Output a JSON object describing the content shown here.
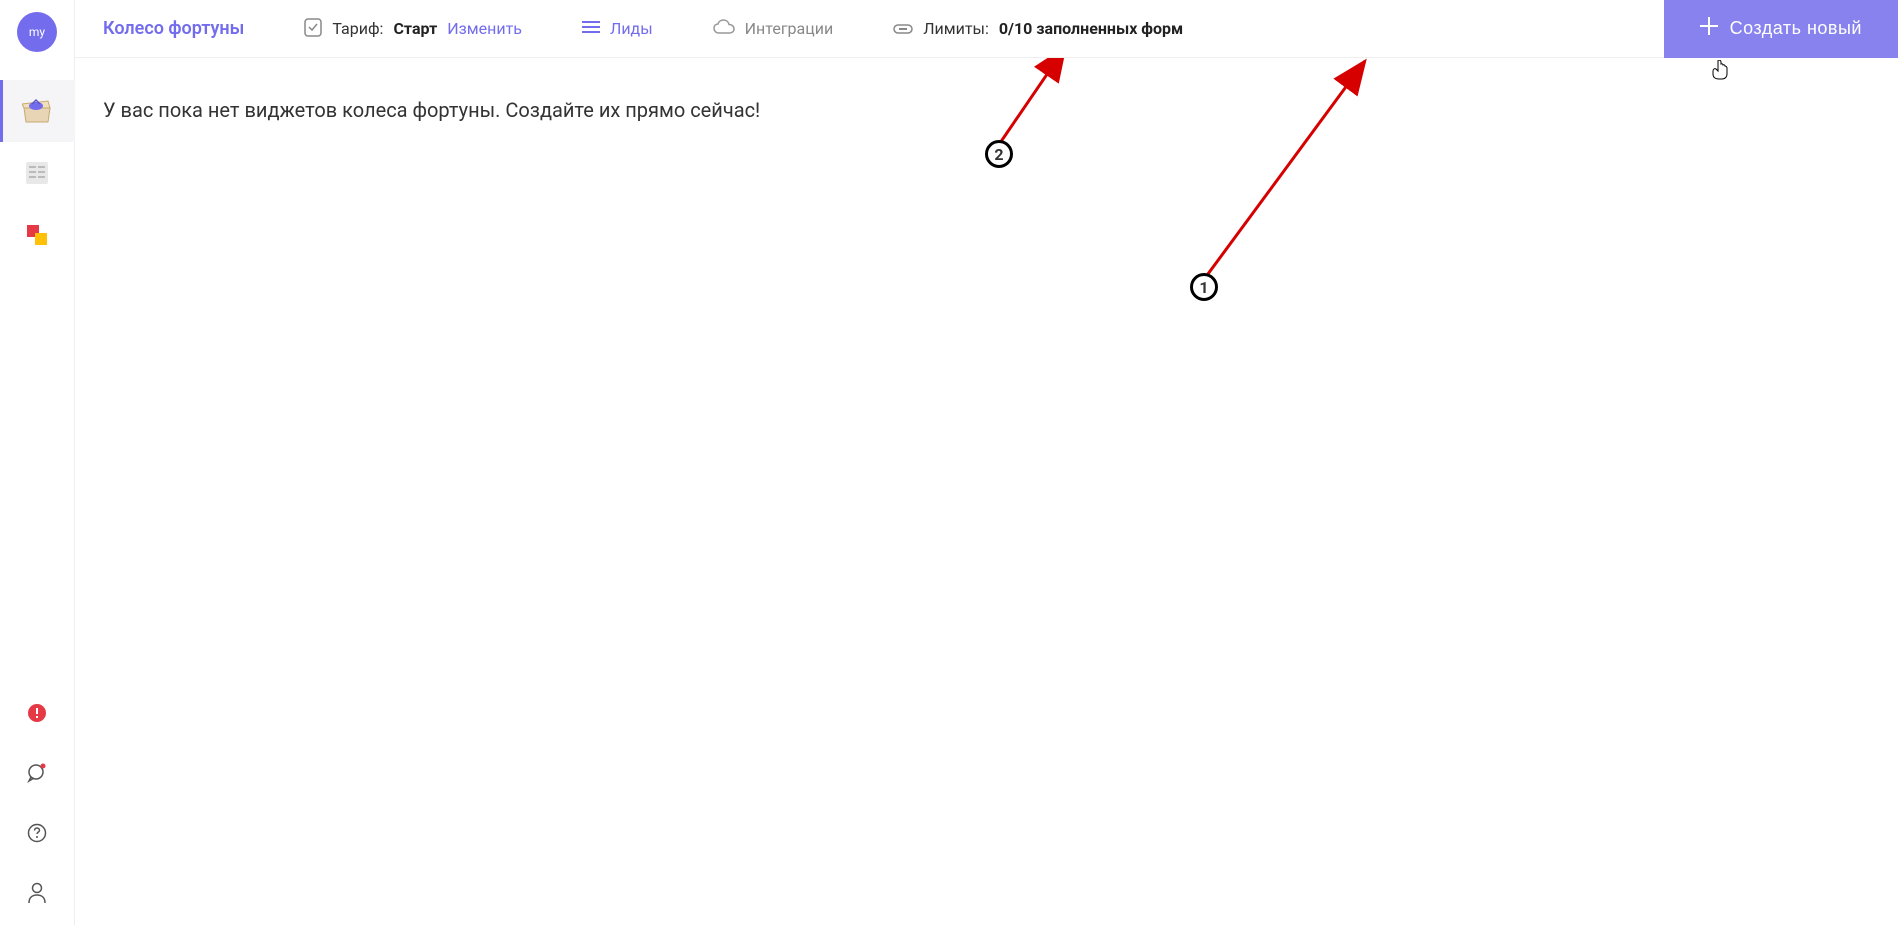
{
  "sidebar": {
    "avatar_text": "my"
  },
  "header": {
    "page_title": "Колесо фортуны",
    "tariff_label": "Тариф:",
    "tariff_value": "Старт",
    "change_link": "Изменить",
    "leads_link": "Лиды",
    "integrations_link": "Интеграции",
    "limits_label": "Лимиты:",
    "limits_value": "0/10 заполненных форм",
    "create_button": "Создать новый"
  },
  "content": {
    "empty_message": "У вас пока нет виджетов колеса фортуны. Создайте их прямо сейчас!"
  },
  "annotations": {
    "marker1": "1",
    "marker2": "2"
  }
}
